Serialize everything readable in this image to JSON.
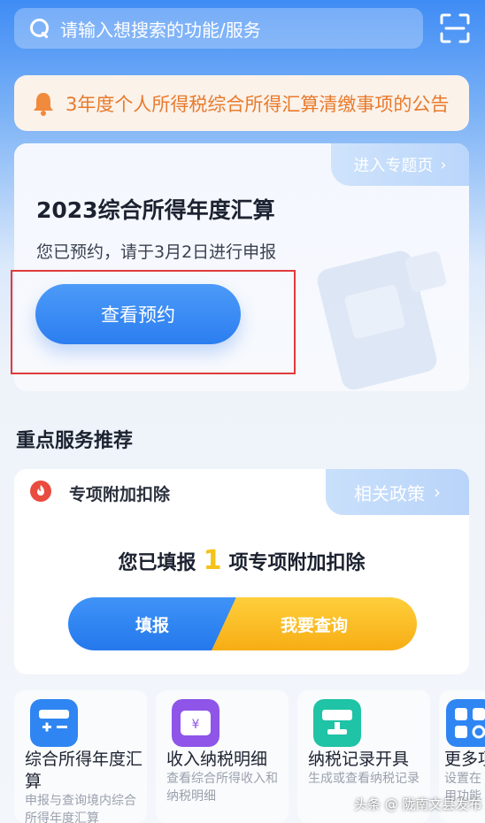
{
  "search": {
    "placeholder": "请输入想搜索的功能/服务"
  },
  "notice": {
    "text": "3年度个人所得税综合所得汇算清缴事项的公告"
  },
  "annual_card": {
    "topic_link": "进入专题页",
    "title": "2023综合所得年度汇算",
    "subtitle": "您已预约，请于3月2日进行申报",
    "view_button": "查看预约"
  },
  "section": {
    "title": "重点服务推荐"
  },
  "deduction": {
    "title": "专项附加扣除",
    "policy_link": "相关政策",
    "filed_prefix": "您已填报",
    "filed_count": "1",
    "filed_suffix": "项专项附加扣除",
    "fill_button": "填报",
    "query_button": "我要查询"
  },
  "services": [
    {
      "title": "综合所得年度汇",
      "title2": "算",
      "desc": "申报与查询境内综合",
      "desc2": "所得年度汇算",
      "icon": "calculator-icon"
    },
    {
      "title": "收入纳税明细",
      "desc": "查看综合所得收入和",
      "desc2": "纳税明细",
      "icon": "wallet-yen-icon"
    },
    {
      "title": "纳税记录开具",
      "desc": "生成或查看纳税记录",
      "icon": "stamp-icon"
    },
    {
      "title": "更多项",
      "desc": "设置在",
      "desc2": "用功能",
      "icon": "grid-search-icon"
    }
  ],
  "watermark": "头条 @ 陇南文县发布",
  "colors": {
    "primary": "#2c7ef0",
    "notice": "#e87a2c",
    "accent": "#f5c21b"
  }
}
